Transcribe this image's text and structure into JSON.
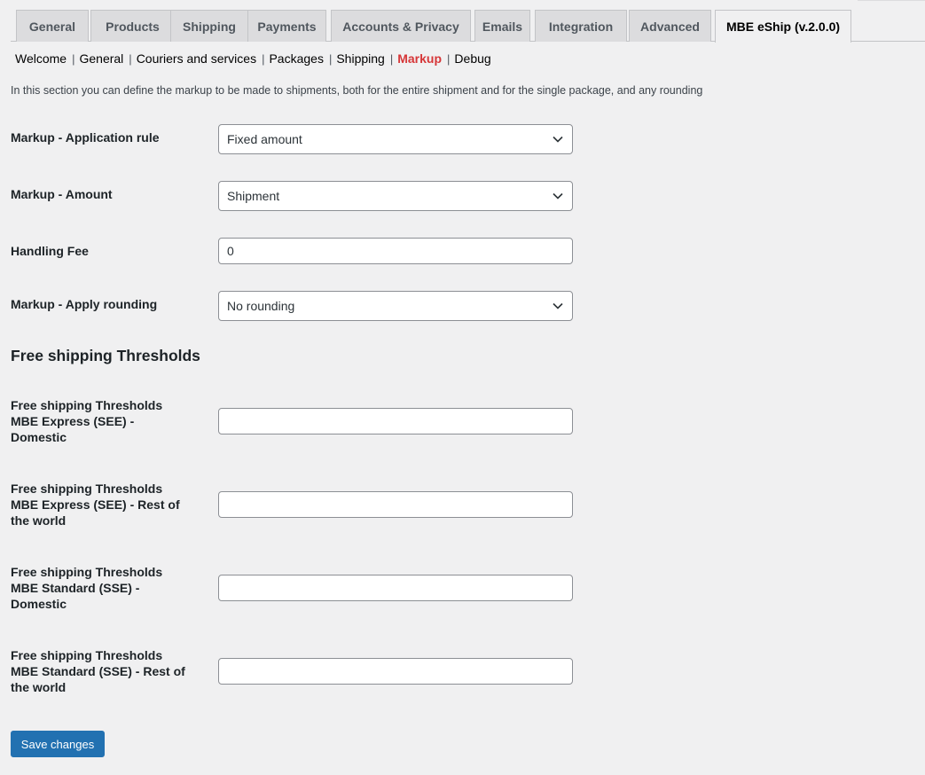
{
  "tabs": [
    {
      "label": "General"
    },
    {
      "label": "Products"
    },
    {
      "label": "Shipping"
    },
    {
      "label": "Payments"
    },
    {
      "label": "Accounts & Privacy"
    },
    {
      "label": "Emails"
    },
    {
      "label": "Integration"
    },
    {
      "label": "Advanced"
    },
    {
      "label": "MBE eShip (v.2.0.0)",
      "active": true
    }
  ],
  "subnav": {
    "items": [
      "Welcome",
      "General",
      "Couriers and services",
      "Packages",
      "Shipping",
      "Markup",
      "Debug"
    ],
    "separator": "|",
    "current": "Markup"
  },
  "description": "In this section you can define the markup to be made to shipments, both for the entire shipment and for the single package, and any rounding",
  "fields": {
    "application_rule": {
      "label": "Markup - Application rule",
      "value": "Fixed amount"
    },
    "amount": {
      "label": "Markup - Amount",
      "value": "Shipment"
    },
    "handling_fee": {
      "label": "Handling Fee",
      "value": "0"
    },
    "rounding": {
      "label": "Markup - Apply rounding",
      "value": "No rounding"
    }
  },
  "free_shipping": {
    "title": "Free shipping Thresholds",
    "fields": [
      {
        "label_lines": [
          "Free shipping Thresholds",
          "MBE Express (SEE) -",
          "Domestic"
        ],
        "value": ""
      },
      {
        "label_lines": [
          "Free shipping Thresholds",
          "MBE Express (SEE) - Rest of",
          "the world"
        ],
        "value": ""
      },
      {
        "label_lines": [
          "Free shipping Thresholds",
          "MBE Standard (SSE) -",
          "Domestic"
        ],
        "value": ""
      },
      {
        "label_lines": [
          "Free shipping Thresholds",
          "MBE Standard (SSE) - Rest of",
          "the world"
        ],
        "value": ""
      }
    ]
  },
  "save_label": "Save changes",
  "colors": {
    "accent": "#2271b1",
    "current_nav": "#d63638",
    "background": "#f0f0f1"
  },
  "icons": {
    "select_arrow": "chevron-down-icon"
  }
}
